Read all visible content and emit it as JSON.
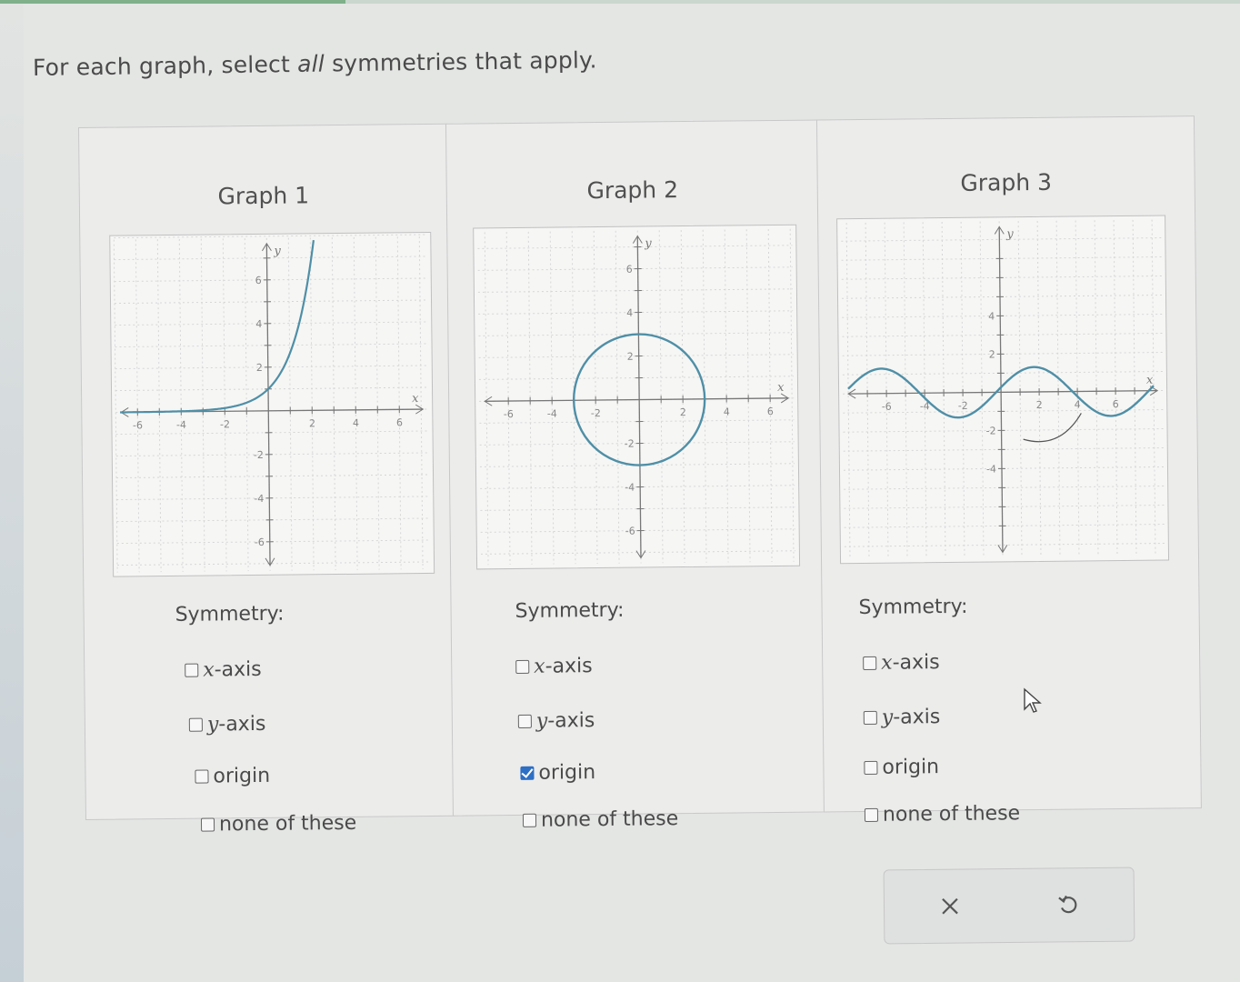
{
  "question": {
    "prefix": "For each graph, select ",
    "emphasis": "all",
    "suffix": " symmetries that apply."
  },
  "graphs": [
    {
      "title": "Graph 1",
      "ticks": {
        "x": [
          "-6",
          "-4",
          "-2",
          "2",
          "4",
          "6"
        ],
        "y": [
          "6",
          "4",
          "2",
          "-2",
          "-4",
          "-6"
        ]
      },
      "axis_labels": {
        "x": "x",
        "y": "y"
      },
      "symmetry_label": "Symmetry:",
      "options": [
        {
          "var": "x",
          "text": "-axis",
          "checked": false
        },
        {
          "var": "y",
          "text": "-axis",
          "checked": false
        },
        {
          "var": "",
          "text": "origin",
          "checked": false
        },
        {
          "var": "",
          "text": "none of these",
          "checked": false
        }
      ]
    },
    {
      "title": "Graph 2",
      "ticks": {
        "x": [
          "-6",
          "-4",
          "-2",
          "2",
          "4",
          "6"
        ],
        "y": [
          "6",
          "4",
          "2",
          "-2",
          "-4",
          "-6"
        ]
      },
      "axis_labels": {
        "x": "x",
        "y": "y"
      },
      "symmetry_label": "Symmetry:",
      "options": [
        {
          "var": "x",
          "text": "-axis",
          "checked": false
        },
        {
          "var": "y",
          "text": "-axis",
          "checked": false
        },
        {
          "var": "",
          "text": "origin",
          "checked": true
        },
        {
          "var": "",
          "text": "none of these",
          "checked": false
        }
      ]
    },
    {
      "title": "Graph 3",
      "ticks": {
        "x": [
          "-6",
          "-4",
          "-2",
          "2",
          "4",
          "6"
        ],
        "y": [
          "4",
          "2",
          "-2",
          "-4"
        ]
      },
      "axis_labels": {
        "x": "x",
        "y": "y"
      },
      "symmetry_label": "Symmetry:",
      "options": [
        {
          "var": "x",
          "text": "-axis",
          "checked": false
        },
        {
          "var": "y",
          "text": "-axis",
          "checked": false
        },
        {
          "var": "",
          "text": "origin",
          "checked": false
        },
        {
          "var": "",
          "text": "none of these",
          "checked": false
        }
      ]
    }
  ],
  "actions": {
    "clear_icon": "close-icon",
    "undo_icon": "undo-icon"
  },
  "colors": {
    "curve": "#4f8fa6",
    "checkbox_checked": "#2d6fc4"
  }
}
